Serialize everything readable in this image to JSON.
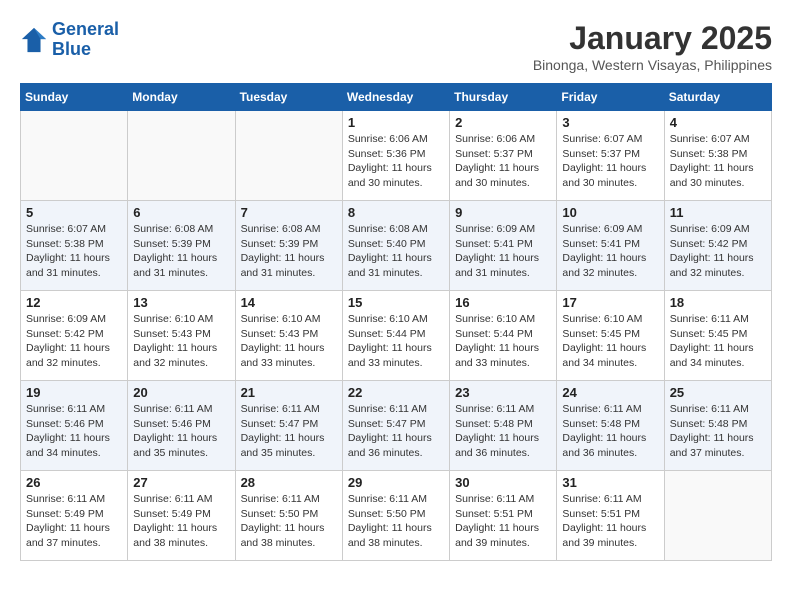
{
  "header": {
    "logo_line1": "General",
    "logo_line2": "Blue",
    "title": "January 2025",
    "subtitle": "Binonga, Western Visayas, Philippines"
  },
  "weekdays": [
    "Sunday",
    "Monday",
    "Tuesday",
    "Wednesday",
    "Thursday",
    "Friday",
    "Saturday"
  ],
  "weeks": [
    [
      {
        "day": "",
        "info": ""
      },
      {
        "day": "",
        "info": ""
      },
      {
        "day": "",
        "info": ""
      },
      {
        "day": "1",
        "info": "Sunrise: 6:06 AM\nSunset: 5:36 PM\nDaylight: 11 hours\nand 30 minutes."
      },
      {
        "day": "2",
        "info": "Sunrise: 6:06 AM\nSunset: 5:37 PM\nDaylight: 11 hours\nand 30 minutes."
      },
      {
        "day": "3",
        "info": "Sunrise: 6:07 AM\nSunset: 5:37 PM\nDaylight: 11 hours\nand 30 minutes."
      },
      {
        "day": "4",
        "info": "Sunrise: 6:07 AM\nSunset: 5:38 PM\nDaylight: 11 hours\nand 30 minutes."
      }
    ],
    [
      {
        "day": "5",
        "info": "Sunrise: 6:07 AM\nSunset: 5:38 PM\nDaylight: 11 hours\nand 31 minutes."
      },
      {
        "day": "6",
        "info": "Sunrise: 6:08 AM\nSunset: 5:39 PM\nDaylight: 11 hours\nand 31 minutes."
      },
      {
        "day": "7",
        "info": "Sunrise: 6:08 AM\nSunset: 5:39 PM\nDaylight: 11 hours\nand 31 minutes."
      },
      {
        "day": "8",
        "info": "Sunrise: 6:08 AM\nSunset: 5:40 PM\nDaylight: 11 hours\nand 31 minutes."
      },
      {
        "day": "9",
        "info": "Sunrise: 6:09 AM\nSunset: 5:41 PM\nDaylight: 11 hours\nand 31 minutes."
      },
      {
        "day": "10",
        "info": "Sunrise: 6:09 AM\nSunset: 5:41 PM\nDaylight: 11 hours\nand 32 minutes."
      },
      {
        "day": "11",
        "info": "Sunrise: 6:09 AM\nSunset: 5:42 PM\nDaylight: 11 hours\nand 32 minutes."
      }
    ],
    [
      {
        "day": "12",
        "info": "Sunrise: 6:09 AM\nSunset: 5:42 PM\nDaylight: 11 hours\nand 32 minutes."
      },
      {
        "day": "13",
        "info": "Sunrise: 6:10 AM\nSunset: 5:43 PM\nDaylight: 11 hours\nand 32 minutes."
      },
      {
        "day": "14",
        "info": "Sunrise: 6:10 AM\nSunset: 5:43 PM\nDaylight: 11 hours\nand 33 minutes."
      },
      {
        "day": "15",
        "info": "Sunrise: 6:10 AM\nSunset: 5:44 PM\nDaylight: 11 hours\nand 33 minutes."
      },
      {
        "day": "16",
        "info": "Sunrise: 6:10 AM\nSunset: 5:44 PM\nDaylight: 11 hours\nand 33 minutes."
      },
      {
        "day": "17",
        "info": "Sunrise: 6:10 AM\nSunset: 5:45 PM\nDaylight: 11 hours\nand 34 minutes."
      },
      {
        "day": "18",
        "info": "Sunrise: 6:11 AM\nSunset: 5:45 PM\nDaylight: 11 hours\nand 34 minutes."
      }
    ],
    [
      {
        "day": "19",
        "info": "Sunrise: 6:11 AM\nSunset: 5:46 PM\nDaylight: 11 hours\nand 34 minutes."
      },
      {
        "day": "20",
        "info": "Sunrise: 6:11 AM\nSunset: 5:46 PM\nDaylight: 11 hours\nand 35 minutes."
      },
      {
        "day": "21",
        "info": "Sunrise: 6:11 AM\nSunset: 5:47 PM\nDaylight: 11 hours\nand 35 minutes."
      },
      {
        "day": "22",
        "info": "Sunrise: 6:11 AM\nSunset: 5:47 PM\nDaylight: 11 hours\nand 36 minutes."
      },
      {
        "day": "23",
        "info": "Sunrise: 6:11 AM\nSunset: 5:48 PM\nDaylight: 11 hours\nand 36 minutes."
      },
      {
        "day": "24",
        "info": "Sunrise: 6:11 AM\nSunset: 5:48 PM\nDaylight: 11 hours\nand 36 minutes."
      },
      {
        "day": "25",
        "info": "Sunrise: 6:11 AM\nSunset: 5:48 PM\nDaylight: 11 hours\nand 37 minutes."
      }
    ],
    [
      {
        "day": "26",
        "info": "Sunrise: 6:11 AM\nSunset: 5:49 PM\nDaylight: 11 hours\nand 37 minutes."
      },
      {
        "day": "27",
        "info": "Sunrise: 6:11 AM\nSunset: 5:49 PM\nDaylight: 11 hours\nand 38 minutes."
      },
      {
        "day": "28",
        "info": "Sunrise: 6:11 AM\nSunset: 5:50 PM\nDaylight: 11 hours\nand 38 minutes."
      },
      {
        "day": "29",
        "info": "Sunrise: 6:11 AM\nSunset: 5:50 PM\nDaylight: 11 hours\nand 38 minutes."
      },
      {
        "day": "30",
        "info": "Sunrise: 6:11 AM\nSunset: 5:51 PM\nDaylight: 11 hours\nand 39 minutes."
      },
      {
        "day": "31",
        "info": "Sunrise: 6:11 AM\nSunset: 5:51 PM\nDaylight: 11 hours\nand 39 minutes."
      },
      {
        "day": "",
        "info": ""
      }
    ]
  ]
}
